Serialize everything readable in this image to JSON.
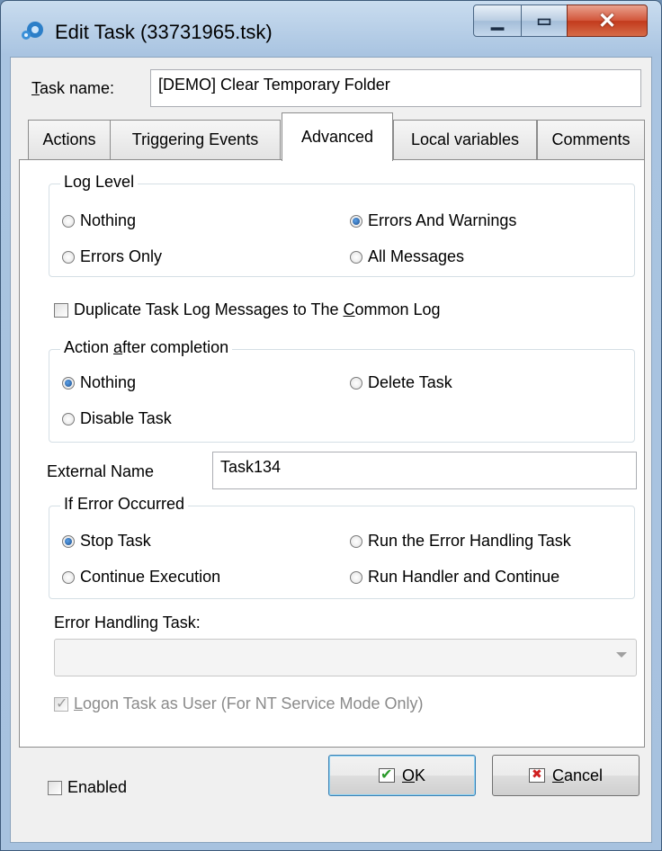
{
  "window": {
    "title": "Edit Task (33731965.tsk)"
  },
  "task_name": {
    "label_prefix": "T",
    "label_rest": "ask name:",
    "value": "[DEMO] Clear Temporary Folder"
  },
  "tabs": [
    {
      "label": "Actions"
    },
    {
      "label": "Triggering Events"
    },
    {
      "label": "Advanced",
      "active": true
    },
    {
      "label": "Local variables"
    },
    {
      "label": "Comments"
    }
  ],
  "log_level": {
    "title": "Log Level",
    "options": [
      {
        "label": "Nothing",
        "checked": false
      },
      {
        "label": "Errors And Warnings",
        "checked": true
      },
      {
        "label": "Errors Only",
        "checked": false
      },
      {
        "label": "All Messages",
        "checked": false
      }
    ]
  },
  "duplicate_log": {
    "label_before": "Duplicate Task Log Messages to The ",
    "label_mnemonic": "C",
    "label_after": "ommon Log",
    "checked": false
  },
  "action_after": {
    "title_before": "Action ",
    "title_mnemonic": "a",
    "title_after": "fter completion",
    "options": [
      {
        "label": "Nothing",
        "checked": true
      },
      {
        "label": "Delete Task",
        "checked": false
      },
      {
        "label": "Disable Task",
        "checked": false
      }
    ]
  },
  "external_name": {
    "label": "External Name",
    "value": "Task134"
  },
  "if_error": {
    "title": "If Error Occurred",
    "options": [
      {
        "label": "Stop Task",
        "checked": true
      },
      {
        "label": "Run the Error Handling Task",
        "checked": false
      },
      {
        "label": "Continue Execution",
        "checked": false
      },
      {
        "label": "Run Handler and Continue",
        "checked": false
      }
    ]
  },
  "error_handling_task": {
    "label": "Error Handling Task:",
    "value": ""
  },
  "logon_as_user": {
    "label_mnemonic": "L",
    "label_rest": "ogon Task as User (For NT Service Mode Only)",
    "checked": true,
    "disabled": true
  },
  "enabled": {
    "label": "Enabled",
    "checked": false
  },
  "buttons": {
    "ok": {
      "mnemonic": "O",
      "rest": "K"
    },
    "cancel": {
      "mnemonic": "C",
      "rest": "ancel"
    }
  }
}
